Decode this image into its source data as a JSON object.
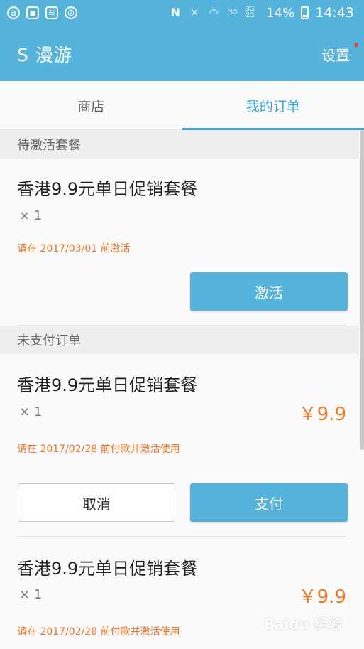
{
  "status_bar": {
    "left_icons": [
      "app-icon",
      "image-icon",
      "wifi-box-icon",
      "blocked-icon"
    ],
    "right_icons": [
      "nfc-icon",
      "mute-icon",
      "wifi-icon"
    ],
    "network_3g": "3G",
    "network_3g_2g": "3G 2G",
    "battery_pct": "14%",
    "time": "14:43"
  },
  "app_bar": {
    "title": "S 漫游",
    "settings_label": "设置"
  },
  "tabs": [
    {
      "label": "商店",
      "active": false
    },
    {
      "label": "我的订单",
      "active": true
    }
  ],
  "sections": {
    "pending_activation": {
      "header": "待激活套餐",
      "order": {
        "title": "香港9.9元单日促销套餐",
        "qty": "× 1",
        "note": "请在 2017/03/01 前激活",
        "action_label": "激活"
      }
    },
    "unpaid": {
      "header": "未支付订单",
      "orders": [
        {
          "title": "香港9.9元单日促销套餐",
          "qty": "× 1",
          "price": "￥9.9",
          "note": "请在 2017/02/28 前付款并激活使用",
          "cancel_label": "取消",
          "pay_label": "支付"
        },
        {
          "title": "香港9.9元单日促销套餐",
          "qty": "× 1",
          "price": "￥9.9",
          "note": "请在 2017/02/28 前付款并激活使用"
        }
      ]
    }
  },
  "colors": {
    "primary": "#56b3db",
    "accent_tab": "#3aa3d3",
    "price": "#f07a2a",
    "note": "#e87628"
  },
  "watermark": "Baidu 经验"
}
